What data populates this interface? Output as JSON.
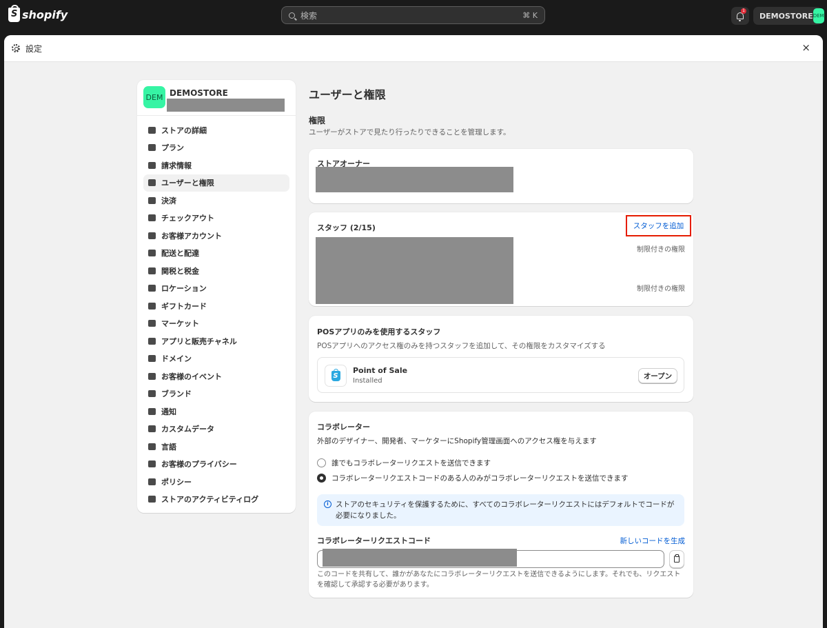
{
  "topbar": {
    "brand": "shopify",
    "search_placeholder": "検索",
    "search_shortcut": "⌘ K",
    "notification_count": "1",
    "store_name": "DEMOSTORE",
    "store_avatar": "DEM"
  },
  "modal": {
    "title": "設定",
    "close": "×"
  },
  "sidebar": {
    "store_name": "DEMOSTORE",
    "store_avatar": "DEM",
    "items": [
      {
        "label": "ストアの詳細",
        "icon": "store-icon"
      },
      {
        "label": "プラン",
        "icon": "plan-icon"
      },
      {
        "label": "請求情報",
        "icon": "billing-icon"
      },
      {
        "label": "ユーザーと権限",
        "icon": "users-icon"
      },
      {
        "label": "決済",
        "icon": "payments-icon"
      },
      {
        "label": "チェックアウト",
        "icon": "cart-icon"
      },
      {
        "label": "お客様アカウント",
        "icon": "person-icon"
      },
      {
        "label": "配送と配達",
        "icon": "truck-icon"
      },
      {
        "label": "関税と税金",
        "icon": "tax-icon"
      },
      {
        "label": "ロケーション",
        "icon": "location-icon"
      },
      {
        "label": "ギフトカード",
        "icon": "gift-card-icon"
      },
      {
        "label": "マーケット",
        "icon": "globe-icon"
      },
      {
        "label": "アプリと販売チャネル",
        "icon": "apps-icon"
      },
      {
        "label": "ドメイン",
        "icon": "domain-icon"
      },
      {
        "label": "お客様のイベント",
        "icon": "cursor-icon"
      },
      {
        "label": "ブランド",
        "icon": "brand-icon"
      },
      {
        "label": "通知",
        "icon": "bell-icon"
      },
      {
        "label": "カスタムデータ",
        "icon": "data-icon"
      },
      {
        "label": "言語",
        "icon": "language-icon"
      },
      {
        "label": "お客様のプライバシー",
        "icon": "lock-icon"
      },
      {
        "label": "ポリシー",
        "icon": "policy-icon"
      },
      {
        "label": "ストアのアクティビティログ",
        "icon": "activity-icon"
      }
    ]
  },
  "main": {
    "title": "ユーザーと権限",
    "permissions_title": "権限",
    "permissions_subtitle": "ユーザーがストアで見たり行ったりできることを管理します。",
    "owner_card": {
      "title": "ストアオーナー"
    },
    "staff_card": {
      "title": "スタッフ (2/15)",
      "add_link": "スタッフを追加",
      "rows": [
        {
          "permission": "制限付きの権限"
        },
        {
          "permission": "制限付きの権限"
        }
      ]
    },
    "pos_card": {
      "title": "POSアプリのみを使用するスタッフ",
      "subtitle": "POSアプリへのアクセス権のみを持つスタッフを追加して、その権限をカスタマイズする",
      "app_name": "Point of Sale",
      "app_status": "Installed",
      "open_button": "オープン"
    },
    "collab_card": {
      "title": "コラボレーター",
      "subtitle": "外部のデザイナー、開発者、マーケターにShopify管理画面へのアクセス権を与えます",
      "option_anyone": "誰でもコラボレーターリクエストを送信できます",
      "option_code": "コラボレーターリクエストコードのある人のみがコラボレーターリクエストを送信できます",
      "selected": "code",
      "banner": "ストアのセキュリティを保護するために、すべてのコラボレーターリクエストにはデフォルトでコードが必要になりました。",
      "code_label": "コラボレーターリクエストコード",
      "generate_link": "新しいコードを生成",
      "help": "このコードを共有して、誰かがあなたにコラボレーターリクエストを送信できるようにします。それでも、リクエストを確認して承認する必要があります。"
    }
  },
  "colors": {
    "accent_link": "#005bd3",
    "store_avatar": "#36f4a4",
    "highlight_box": "#e51c00"
  }
}
